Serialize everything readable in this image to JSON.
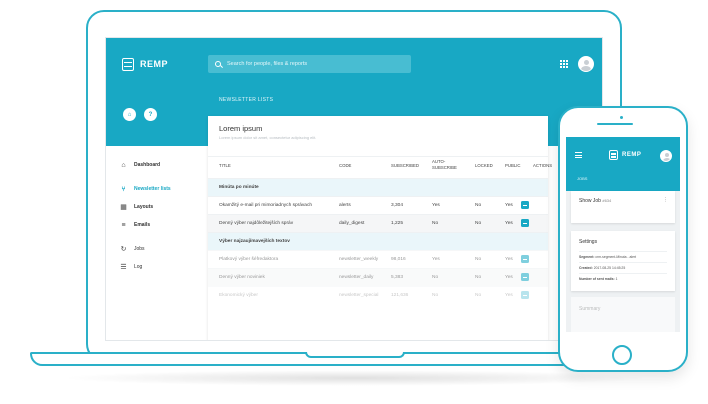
{
  "app": {
    "logo_text": "REMP",
    "search_placeholder": "Search for people, files & reports"
  },
  "hero": {
    "section_label": "NEWSLETTER LISTS",
    "home_icon": "home-icon",
    "help_icon": "help-icon"
  },
  "sidebar": {
    "items": [
      {
        "label": "Dashboard",
        "icon": "home-icon",
        "active": false
      },
      {
        "label": "Newsletter lists",
        "icon": "network-icon",
        "active": true
      },
      {
        "label": "Layouts",
        "icon": "grid-icon",
        "active": false
      },
      {
        "label": "Emails",
        "icon": "list-icon",
        "active": false
      },
      {
        "label": "Jobs",
        "icon": "refresh-icon",
        "active": false
      },
      {
        "label": "Log",
        "icon": "log-icon",
        "active": false
      }
    ]
  },
  "card": {
    "title": "Lorem ipsum",
    "subtitle": "Lorem ipsum dolor sit amet, consectetur adipiscing elit.",
    "columns": [
      "TITLE",
      "CODE",
      "SUBSCRIBED",
      "AUTO-\nSUBSCRIBE",
      "LOCKED",
      "PUBLIC",
      "ACTIONS"
    ],
    "col_title": "TITLE",
    "col_code": "CODE",
    "col_subscribed": "SUBSCRIBED",
    "col_auto1": "AUTO-",
    "col_auto2": "SUBSCRIBE",
    "col_locked": "LOCKED",
    "col_public": "PUBLIC",
    "col_actions": "ACTIONS",
    "groups": [
      {
        "name": "Minúta po minúte",
        "rows": [
          {
            "title": "Okamžitý e-mail pri mimoriadnych správach",
            "code": "alerts",
            "subscribed": "3,304",
            "auto": "Yes",
            "locked": "No",
            "public": "Yes"
          },
          {
            "title": "Denný výber najdôležitejších správ",
            "code": "daily_digest",
            "subscribed": "1,225",
            "auto": "No",
            "locked": "No",
            "public": "Yes"
          }
        ]
      },
      {
        "name": "Výber najzaujímavejších textov",
        "rows": [
          {
            "title": "Platkový výber šéfredaktora",
            "code": "newsletter_weekly",
            "subscribed": "98,016",
            "auto": "Yes",
            "locked": "No",
            "public": "Yes"
          },
          {
            "title": "Denný výber noviniek",
            "code": "newsletter_daily",
            "subscribed": "5,383",
            "auto": "No",
            "locked": "No",
            "public": "Yes"
          },
          {
            "title": "Ekonomický výber",
            "code": "newsletter_special",
            "subscribed": "121,636",
            "auto": "No",
            "locked": "No",
            "public": "Yes"
          }
        ]
      }
    ]
  },
  "phone": {
    "logo_text": "REMP",
    "section_label": "JOBS",
    "job_title": "Show Job",
    "job_id": "#634",
    "settings_title": "Settings",
    "segment_label": "Segment:",
    "segment_value": "crm-segment-Minuta - alert",
    "created_label": "Created:",
    "created_value": "2017-08-25 14:45:25",
    "threads_label": "Number of sent mails:",
    "threads_value": "1",
    "summary_title": "Summary"
  },
  "colors": {
    "accent": "#18a8c4",
    "device_outline": "#2ab0c8",
    "group_row": "#eaf6fa"
  }
}
